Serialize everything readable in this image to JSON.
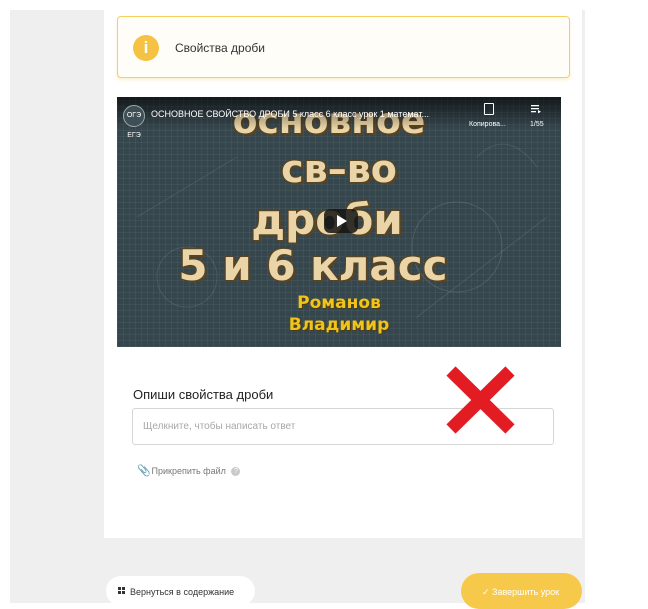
{
  "info": {
    "icon": "info-icon",
    "icon_glyph": "i",
    "title": "Свойства дроби",
    "accent": "#f6c243"
  },
  "video": {
    "channel_logo": "ОГЭ ЕГЭ",
    "title": "ОСНОВНОЕ СВОЙСТВО ДРОБИ 5 класс 6 класс урок 1 математ...",
    "copy_label": "Копирова...",
    "playlist_count": "1/55",
    "thumb_line1": "основное",
    "thumb_line2": "св–во",
    "thumb_line3": "дроби",
    "thumb_line4": "5 и 6 класс",
    "thumb_author1": "Романов",
    "thumb_author2": "Владимир"
  },
  "question": {
    "label": "Опиши свойства дроби",
    "placeholder": "Щелкните, чтобы написать ответ",
    "value": "",
    "mark": "wrong-cross-mark",
    "mark_color": "#e31b23"
  },
  "attach": {
    "label": "Прикрепить файл",
    "help_glyph": "?"
  },
  "footer": {
    "back_label": "Вернуться в содержание",
    "finish_label": "✓ Завершить урок",
    "finish_color": "#f7c94a"
  }
}
